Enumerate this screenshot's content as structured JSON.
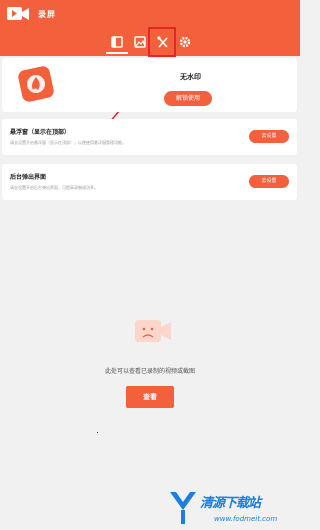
{
  "header": {
    "app_name": "录屏",
    "tabs": [
      {
        "icon": "video-list-icon"
      },
      {
        "icon": "image-icon"
      },
      {
        "icon": "tools-icon"
      },
      {
        "icon": "gear-icon"
      }
    ]
  },
  "watermark_card": {
    "title": "无水印",
    "button_label": "解锁使用"
  },
  "settings": [
    {
      "title": "悬浮窗（显示在顶部）",
      "description": "请去设置开启悬浮窗（显示在顶部），以便使用悬浮窗管理功能。",
      "button_label": "去设置"
    },
    {
      "title": "后台弹出界面",
      "description": "请去设置开启后台弹出界面，可提高录制成功率。",
      "button_label": "去设置"
    }
  ],
  "empty_state": {
    "message": "此处可以查看已录制的视频或截图",
    "button_label": "查看"
  },
  "watermark_site": {
    "name": "清源下载站",
    "url": "www.fodmeit.com"
  },
  "colors": {
    "accent": "#f2603c",
    "highlight": "#e4262a",
    "watermark_blue": "#1c7ee0"
  }
}
